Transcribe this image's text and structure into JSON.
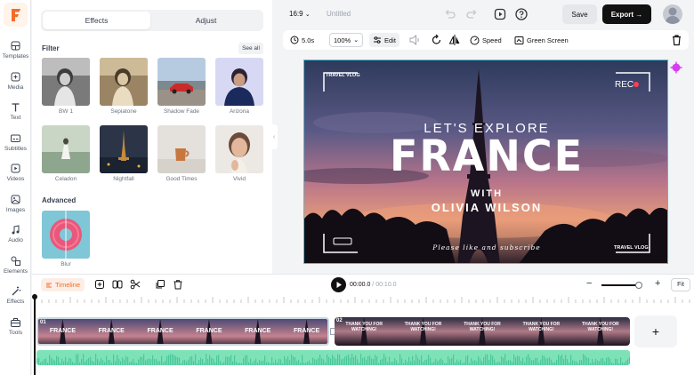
{
  "nav": [
    {
      "label": "Templates",
      "icon": "grid-icon"
    },
    {
      "label": "Media",
      "icon": "media-add-icon"
    },
    {
      "label": "Text",
      "icon": "text-icon"
    },
    {
      "label": "Subtitles",
      "icon": "subtitles-icon"
    },
    {
      "label": "Videos",
      "icon": "video-icon"
    },
    {
      "label": "Images",
      "icon": "image-icon"
    },
    {
      "label": "Audio",
      "icon": "music-icon"
    },
    {
      "label": "Elements",
      "icon": "shapes-icon"
    },
    {
      "label": "Effects",
      "icon": "effects-icon"
    },
    {
      "label": "Tools",
      "icon": "toolbox-icon"
    }
  ],
  "panel": {
    "tabs": [
      "Effects",
      "Adjust"
    ],
    "filter_title": "Filter",
    "see_all": "See all",
    "filters": [
      "BW 1",
      "Sepiatone",
      "Shadow Fade",
      "Arizona",
      "Celadon",
      "Nightfall",
      "Good Times",
      "Vivid"
    ],
    "advanced_title": "Advanced",
    "advanced": [
      "Blur"
    ]
  },
  "topbar": {
    "ratio": "16:9",
    "title": "Untitled",
    "save": "Save",
    "export": "Export"
  },
  "toolbar": {
    "duration": "5.0s",
    "zoom": "100%",
    "edit": "Edit",
    "speed": "Speed",
    "green_screen": "Green Screen"
  },
  "canvas": {
    "tag_top": "TRAVEL VLOG",
    "rec": "REC",
    "line1": "LET'S EXPLORE",
    "line2": "FRANCE",
    "line3": "WITH",
    "line4": "OLIVIA WILSON",
    "script": "Please like and subscribe",
    "tag_bottom": "TRAVEL VLOG"
  },
  "timeline": {
    "label": "Timeline",
    "current": "00:00.0",
    "separator": " / ",
    "total": "00:10.0",
    "zoom_level": 0.95,
    "fit": "Fit",
    "clip1_tag": "01",
    "clip1_text": "FRANCE",
    "clip2_tag": "02",
    "clip2_text": "THANK YOU FOR WATCHING!"
  },
  "colors": {
    "accent": "#f26b2a",
    "selection": "#39c6e0",
    "audio": "#7ee2b8"
  }
}
